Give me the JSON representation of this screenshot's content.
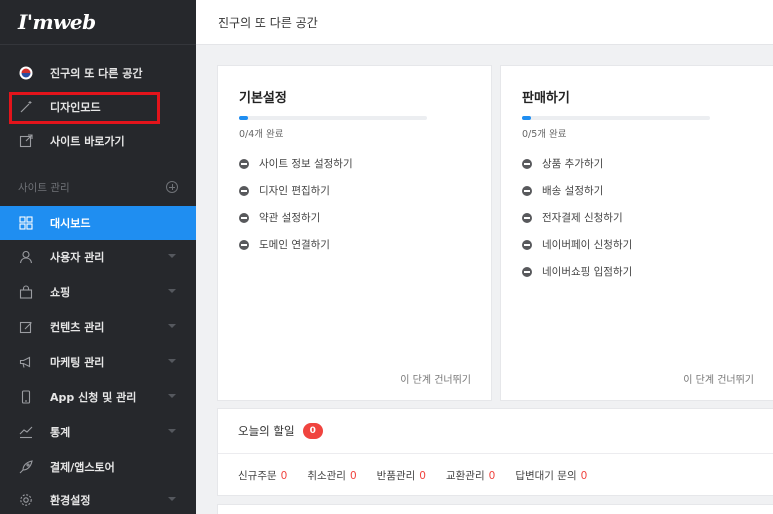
{
  "brand": {
    "logo_text": "I'mweb"
  },
  "sidebar": {
    "site_items": [
      {
        "label": "진구의 또 다른 공간",
        "icon": "korea-flag-icon"
      },
      {
        "label": "디자인모드",
        "icon": "magic-wand-icon"
      },
      {
        "label": "사이트 바로가기",
        "icon": "external-link-icon"
      }
    ],
    "section_label": "사이트 관리",
    "section_action_icon": "plus-circle-icon",
    "menu": [
      {
        "label": "대시보드",
        "icon": "dashboard-grid-icon",
        "active": true
      },
      {
        "label": "사용자 관리",
        "icon": "user-icon"
      },
      {
        "label": "쇼핑",
        "icon": "shopping-bag-icon"
      },
      {
        "label": "컨텐츠 관리",
        "icon": "edit-icon"
      },
      {
        "label": "마케팅 관리",
        "icon": "megaphone-icon"
      },
      {
        "label": "App 신청 및 관리",
        "icon": "mobile-icon"
      },
      {
        "label": "통계",
        "icon": "chart-icon"
      },
      {
        "label": "결제/앱스토어",
        "icon": "rocket-icon"
      },
      {
        "label": "환경설정",
        "icon": "settings-icon"
      }
    ]
  },
  "header": {
    "title": "진구의 또 다른 공간"
  },
  "basic_settings": {
    "title": "기본설정",
    "progress": 0,
    "progress_text": "0/4개 완료",
    "items": [
      "사이트 정보 설정하기",
      "디자인 편집하기",
      "약관 설정하기",
      "도메인 연결하기"
    ],
    "skip_label": "이 단계 건너뛰기"
  },
  "selling": {
    "title": "판매하기",
    "progress": 0,
    "progress_text": "0/5개 완료",
    "items": [
      "상품 추가하기",
      "배송 설정하기",
      "전자결제 신청하기",
      "네이버페이 신청하기",
      "네이버쇼핑 입점하기"
    ],
    "skip_label": "이 단계 건너뛰기"
  },
  "today": {
    "title": "오늘의 할일",
    "badge": "0",
    "stats": [
      {
        "label": "신규주문",
        "value": "0"
      },
      {
        "label": "취소관리",
        "value": "0"
      },
      {
        "label": "반품관리",
        "value": "0"
      },
      {
        "label": "교환관리",
        "value": "0"
      },
      {
        "label": "답변대기 문의",
        "value": "0"
      }
    ]
  },
  "colors": {
    "accent": "#1f8ef1",
    "sidebar_bg": "#26282c",
    "alert": "#f0443f",
    "highlight_box": "#e3141b"
  }
}
